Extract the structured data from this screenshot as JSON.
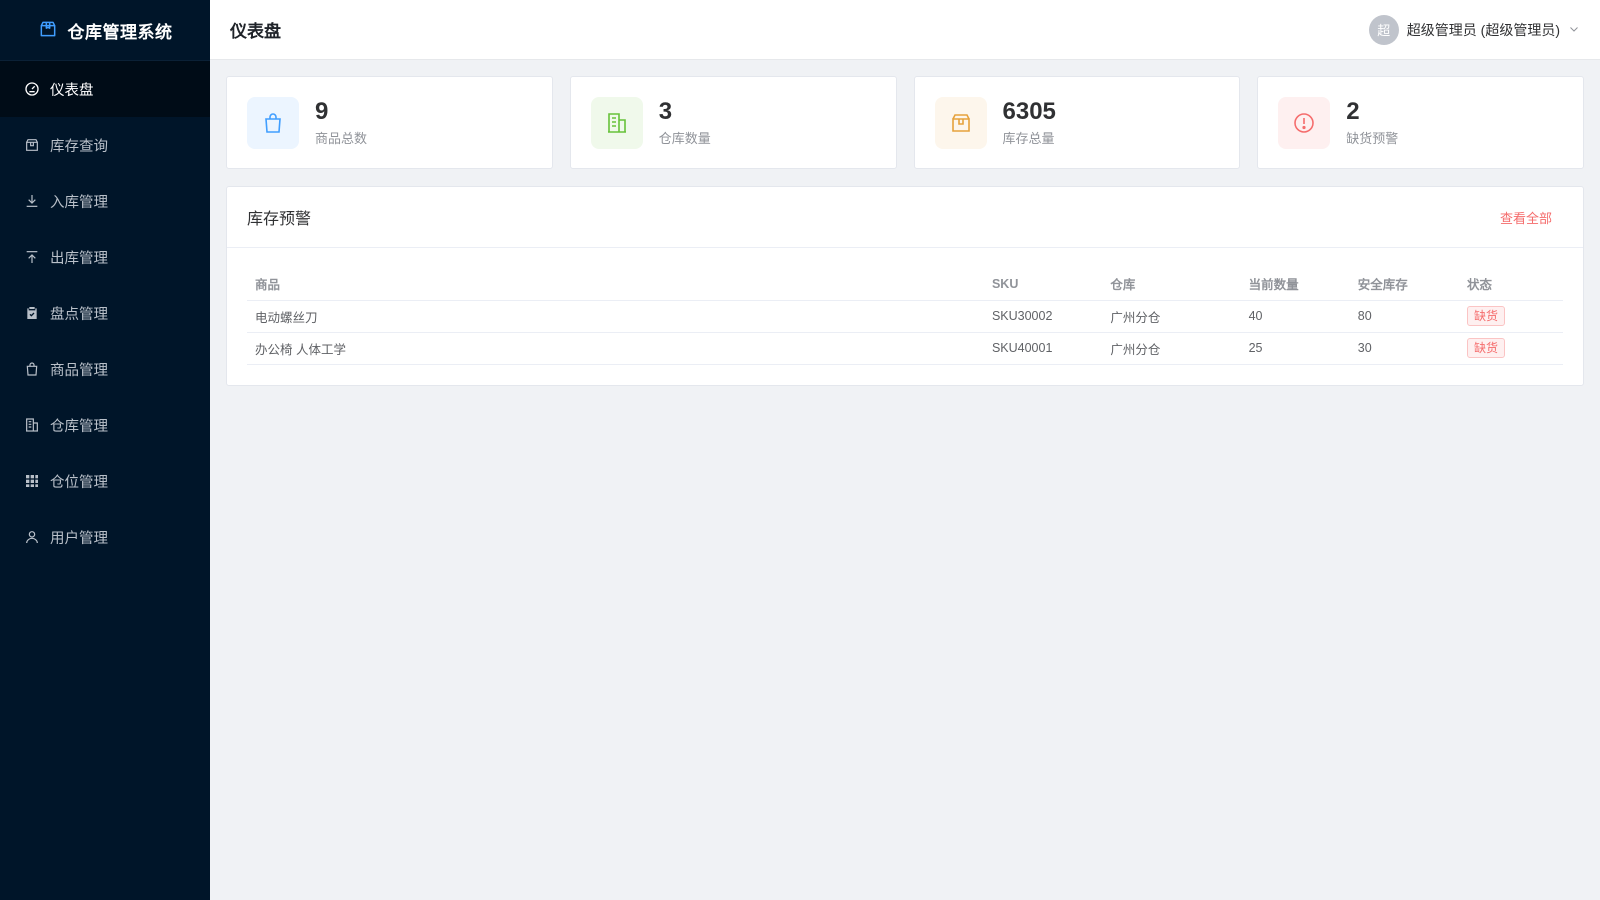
{
  "app": {
    "title": "仓库管理系统",
    "logo_icon": "box-icon"
  },
  "sidebar": {
    "items": [
      {
        "label": "仪表盘",
        "icon": "dashboard-icon",
        "active": true
      },
      {
        "label": "库存查询",
        "icon": "box-icon"
      },
      {
        "label": "入库管理",
        "icon": "download-icon"
      },
      {
        "label": "出库管理",
        "icon": "upload-icon"
      },
      {
        "label": "盘点管理",
        "icon": "clipboard-check-icon"
      },
      {
        "label": "商品管理",
        "icon": "shopping-bag-icon"
      },
      {
        "label": "仓库管理",
        "icon": "building-icon"
      },
      {
        "label": "仓位管理",
        "icon": "grid-icon"
      },
      {
        "label": "用户管理",
        "icon": "user-icon"
      }
    ]
  },
  "header": {
    "title": "仪表盘",
    "user": {
      "avatar_text": "超",
      "name": "超级管理员 (超级管理员)"
    }
  },
  "stats": [
    {
      "value": "9",
      "label": "商品总数",
      "icon": "shopping-bag-icon",
      "color": "#409eff",
      "bg": "#ecf5ff"
    },
    {
      "value": "3",
      "label": "仓库数量",
      "icon": "building-icon",
      "color": "#67c23a",
      "bg": "#f0f9eb"
    },
    {
      "value": "6305",
      "label": "库存总量",
      "icon": "box-icon",
      "color": "#e6a23c",
      "bg": "#fdf6ec"
    },
    {
      "value": "2",
      "label": "缺货预警",
      "icon": "warning-circle-icon",
      "color": "#f56c6c",
      "bg": "#fef0f0"
    }
  ],
  "alerts": {
    "title": "库存预警",
    "view_all": "查看全部",
    "columns": [
      "商品",
      "SKU",
      "仓库",
      "当前数量",
      "安全库存",
      "状态"
    ],
    "rows": [
      {
        "product": "电动螺丝刀",
        "sku": "SKU30002",
        "warehouse": "广州分仓",
        "current": "40",
        "safety": "80",
        "status": "缺货"
      },
      {
        "product": "办公椅 人体工学",
        "sku": "SKU40001",
        "warehouse": "广州分仓",
        "current": "25",
        "safety": "30",
        "status": "缺货"
      }
    ]
  },
  "colors": {
    "sidebar_bg": "#001529",
    "accent": "#409eff",
    "danger": "#f56c6c"
  }
}
